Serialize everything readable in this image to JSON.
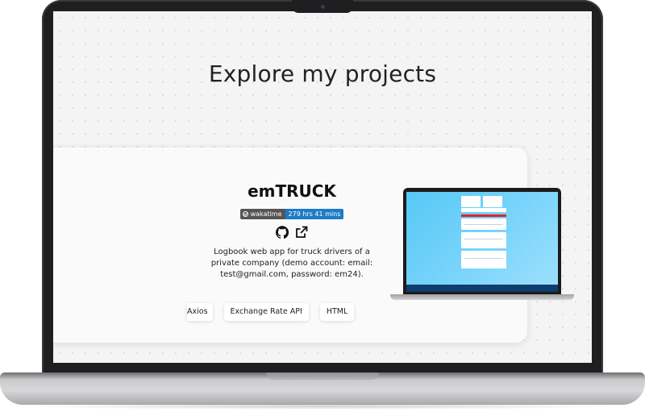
{
  "page": {
    "section_title": "Explore my projects"
  },
  "project": {
    "name": "emTRUCK",
    "badge": {
      "label": "wakatime",
      "value": "279 hrs 41 mins"
    },
    "links": [
      {
        "icon": "github-icon"
      },
      {
        "icon": "external-link-icon"
      }
    ],
    "description": "Logbook web app for truck drivers of a private company (demo account: email: test@gmail.com, password: em24).",
    "technologies": [
      "Axios",
      "Exchange Rate API",
      "HTML"
    ]
  },
  "colors": {
    "badge_left": "#555555",
    "badge_right": "#1e7bc5",
    "preview_screen": "#56c8f5",
    "preview_accent": "#e0242c"
  }
}
